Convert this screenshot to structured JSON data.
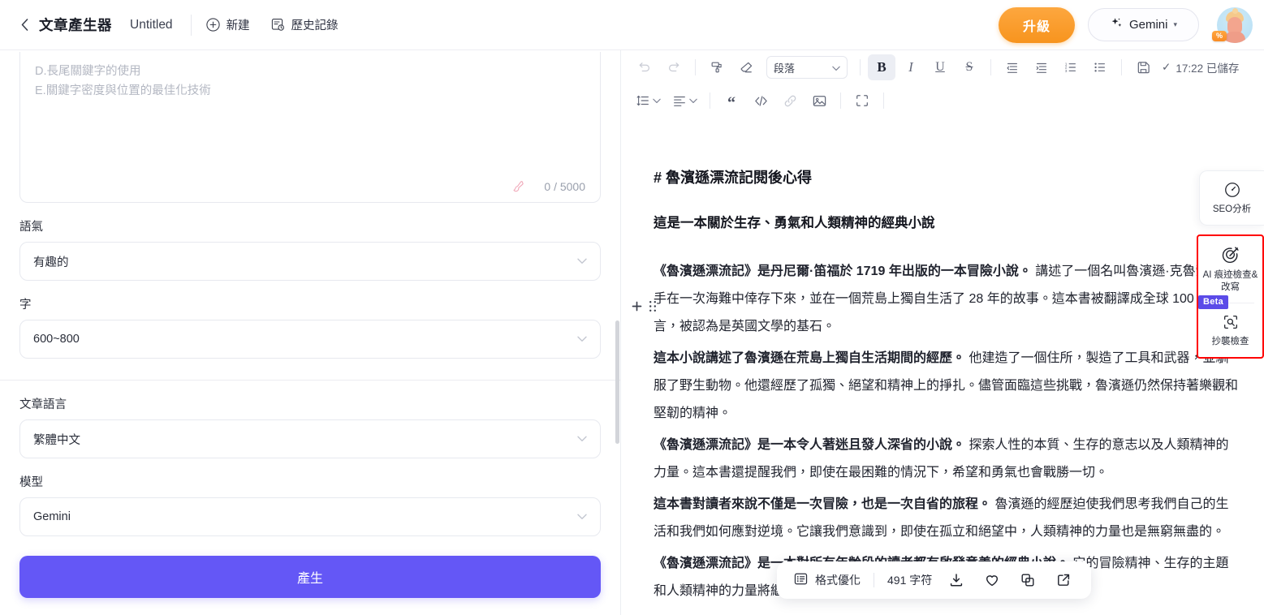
{
  "topbar": {
    "back_icon": "chevron-left-icon",
    "app_title": "文章產生器",
    "doc_title": "Untitled",
    "new_label": "新建",
    "history_label": "歷史記錄",
    "upgrade_label": "升級",
    "model_label": "Gemini",
    "model_caret": "▾",
    "avatar_badge": "%"
  },
  "left_panel": {
    "prompt": {
      "placeholder_line1": "D.長尾關鍵字的使用",
      "placeholder_line2": "E.關鍵字密度與位置的最佳化技術",
      "value": "",
      "counter": "0 / 5000",
      "clear_icon": "brush-clear-icon"
    },
    "fields": [
      {
        "label": "語氣",
        "value": "有趣的"
      },
      {
        "label": "字",
        "value": "600~800"
      },
      {
        "label": "文章語言",
        "value": "繁體中文"
      },
      {
        "label": "模型",
        "value": "Gemini"
      }
    ],
    "generate_label": "產生"
  },
  "editor": {
    "toolbar_row1": [
      {
        "name": "undo-icon",
        "label": ""
      },
      {
        "name": "redo-icon",
        "label": ""
      },
      {
        "name": "format-painter-icon",
        "label": ""
      },
      {
        "name": "clear-format-icon",
        "label": ""
      },
      {
        "name": "paragraph-style-select",
        "label": "段落"
      },
      {
        "name": "bold-icon",
        "label": "B"
      },
      {
        "name": "italic-icon",
        "label": "I"
      },
      {
        "name": "underline-icon",
        "label": "U"
      },
      {
        "name": "strikethrough-icon",
        "label": "S"
      },
      {
        "name": "outdent-icon",
        "label": ""
      },
      {
        "name": "indent-icon",
        "label": ""
      },
      {
        "name": "ordered-list-icon",
        "label": ""
      },
      {
        "name": "bullet-list-icon",
        "label": ""
      },
      {
        "name": "save-icon",
        "label": ""
      }
    ],
    "paragraph_style": "段落",
    "bold_label": "B",
    "italic_label": "I",
    "underline_label": "U",
    "strike_label": "S",
    "saved_status": "17:22 已儲存",
    "saved_check": "✓",
    "toolbar_row2": [
      {
        "name": "line-height-icon"
      },
      {
        "name": "text-align-icon"
      },
      {
        "name": "blockquote-icon"
      },
      {
        "name": "code-block-icon"
      },
      {
        "name": "link-icon"
      },
      {
        "name": "image-icon"
      },
      {
        "name": "fullscreen-icon"
      }
    ]
  },
  "document": {
    "heading": "# 魯濱遜漂流記閱後心得",
    "subheading": "這是一本關於生存、勇氣和人類精神的經典小說",
    "paragraphs": [
      {
        "lead": "《魯濱遜漂流記》是丹尼爾·笛福於 1719 年出版的一本冒險小說。",
        "rest": " 講述了一個名叫魯濱遜·克魯索的水手在一次海難中倖存下來，並在一個荒島上獨自生活了 28 年的故事。這本書被翻譯成全球 100 多種語言，被認為是英國文學的基石。"
      },
      {
        "lead": "這本小說講述了魯濱遜在荒島上獨自生活期間的經歷。",
        "rest": " 他建造了一個住所，製造了工具和武器，並馴服了野生動物。他還經歷了孤獨、絕望和精神上的掙扎。儘管面臨這些挑戰，魯濱遜仍然保持著樂觀和堅韌的精神。"
      },
      {
        "lead": "《魯濱遜漂流記》是一本令人著迷且發人深省的小說。",
        "rest": " 探索人性的本質、生存的意志以及人類精神的力量。這本書還提醒我們，即使在最困難的情況下，希望和勇氣也會戰勝一切。"
      },
      {
        "lead": "這本書對讀者來說不僅是一次冒險，也是一次自省的旅程。",
        "rest": " 魯濱遜的經歷迫使我們思考我們自己的生活和我們如何應對逆境。它讓我們意識到，即使在孤立和絕望中，人類精神的力量也是無窮無盡的。"
      },
      {
        "lead": "《魯濱遜漂流記》是一本對所有年齡段的讀者都有啟發意義的經典小說。",
        "rest": " 它的冒險精神、生存的主題和人類精神的力量將繼續激勵和鼓舞讀者幾代人。它是文學中上必讀的一書。"
      }
    ]
  },
  "rail": {
    "seo": {
      "label": "SEO分析",
      "icon": "gauge-icon"
    },
    "ai_detect": {
      "label": "AI 痕迹檢查&改寫",
      "icon": "ai-rewrite-icon"
    },
    "plagiarism": {
      "label": "抄襲檢查",
      "icon": "plagiarism-search-icon",
      "badge": "Beta"
    },
    "highlight_color": "#FF0000"
  },
  "floatbar": {
    "format_label": "格式優化",
    "char_count": "491 字符",
    "actions": [
      {
        "name": "download-icon"
      },
      {
        "name": "favorite-heart-icon"
      },
      {
        "name": "copy-icon"
      },
      {
        "name": "export-external-icon"
      }
    ]
  }
}
